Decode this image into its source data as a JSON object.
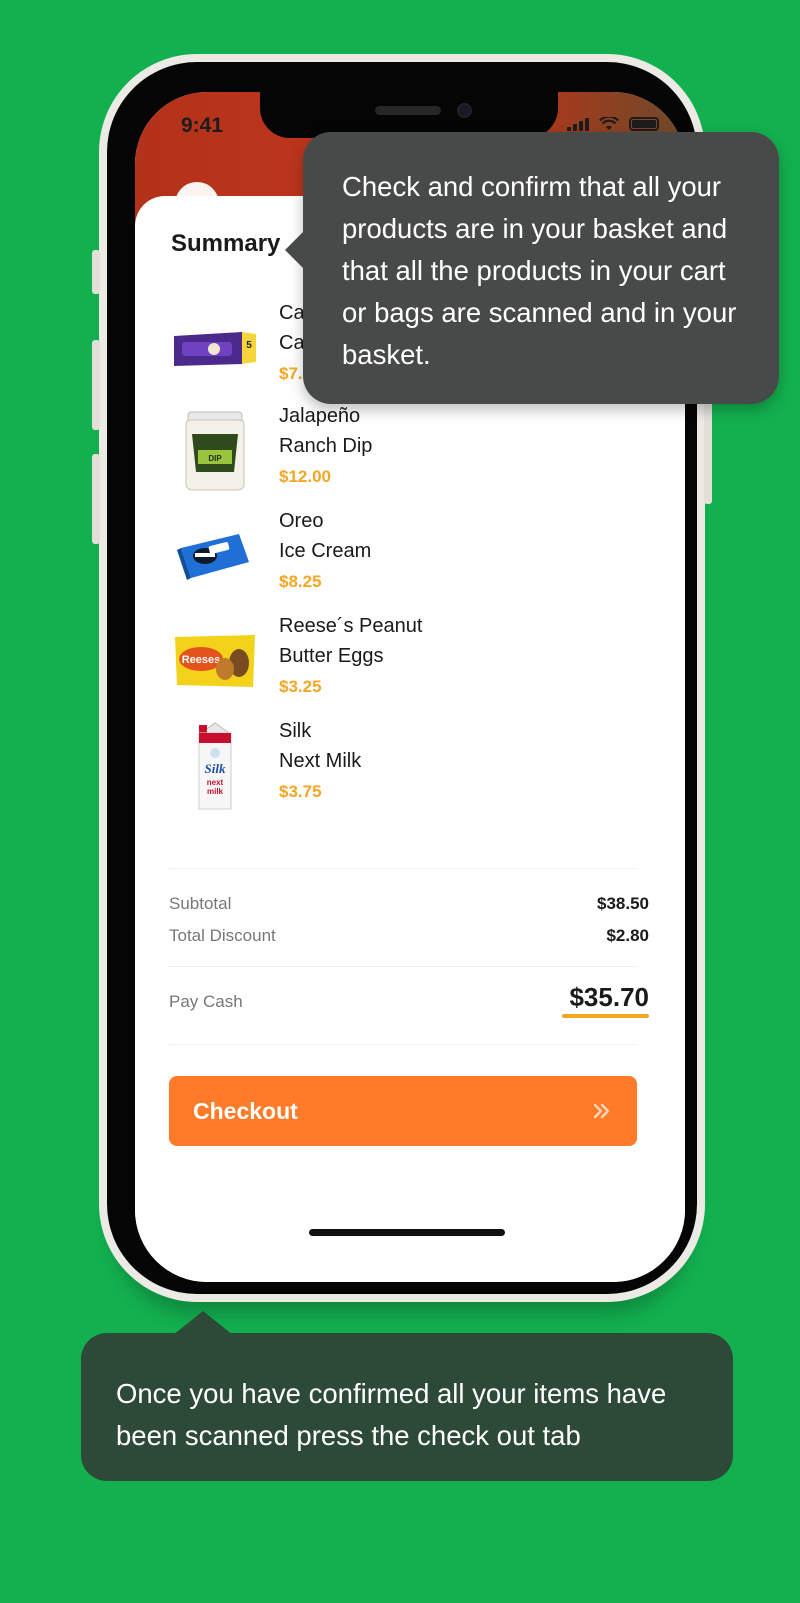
{
  "status_bar": {
    "time": "9:41"
  },
  "summary": {
    "title": "Summary"
  },
  "items": [
    {
      "name_line1": "Ca",
      "name_line2": "Ca",
      "price": "$7.5",
      "icon": "chocolate-box-icon"
    },
    {
      "name_line1": "Jalapeño",
      "name_line2": "Ranch Dip",
      "price": "$12.00",
      "icon": "dip-jar-icon"
    },
    {
      "name_line1": "Oreo",
      "name_line2": "Ice Cream",
      "price": "$8.25",
      "icon": "ice-cream-box-icon"
    },
    {
      "name_line1": "Reese´s Peanut",
      "name_line2": "Butter Eggs",
      "price": "$3.25",
      "icon": "candy-bag-icon"
    },
    {
      "name_line1": "Silk",
      "name_line2": "Next Milk",
      "price": "$3.75",
      "icon": "milk-carton-icon"
    }
  ],
  "totals": {
    "subtotal_label": "Subtotal",
    "subtotal_value": "$38.50",
    "discount_label": "Total Discount",
    "discount_value": "$2.80",
    "pay_label": "Pay Cash",
    "pay_value": "$35.70"
  },
  "checkout": {
    "label": "Checkout"
  },
  "tooltips": {
    "top": "Check and confirm that all your products are in your basket and that all the products in your cart or bags are scanned and in your basket.",
    "bottom": "Once you have confirmed all your items have been scanned press the check out tab"
  },
  "colors": {
    "background": "#13b04f",
    "accent_orange": "#ff7a29",
    "price_yellow": "#f5a623",
    "tooltip_dark": "#484a49",
    "tooltip_green": "#2c4a37"
  }
}
